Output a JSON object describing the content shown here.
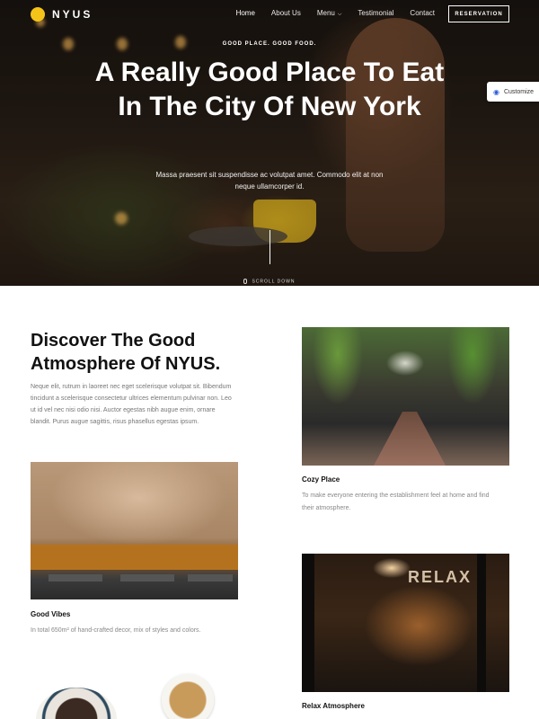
{
  "brand": {
    "name": "NYUS",
    "accent": "#f5c419"
  },
  "nav": {
    "items": [
      {
        "label": "Home",
        "active": true
      },
      {
        "label": "About Us"
      },
      {
        "label": "Menu",
        "has_dropdown": true
      },
      {
        "label": "Testimonial"
      },
      {
        "label": "Contact"
      }
    ],
    "reservation_label": "RESERVATION"
  },
  "customize_label": "Customize",
  "hero": {
    "eyebrow": "GOOD PLACE. GOOD FOOD.",
    "title": "A Really Good Place To Eat In The City Of New York",
    "subtitle": "Massa praesent sit suspendisse ac volutpat amet. Commodo elit at non neque ullamcorper id.",
    "scroll_label": "SCROLL DOWN"
  },
  "discover": {
    "title": "Discover The Good Atmosphere Of NYUS.",
    "body": "Neque elit, rutrum in laoreet nec eget scelerisque volutpat sit. Bibendum tincidunt a scelerisque consectetur ultrices elementum pulvinar non. Leo ut id vel nec nisi odio nisi. Auctor egestas nibh augue enim, ornare blandit. Purus augue sagittis, risus phasellus egestas ipsum."
  },
  "features": {
    "cozy": {
      "title": "Cozy Place",
      "body": "To make everyone entering the establishment feel at home and find their atmosphere."
    },
    "vibes": {
      "title": "Good Vibes",
      "body": "In total 650m² of hand-crafted decor, mix of styles and colors."
    },
    "relax": {
      "title": "Relax Atmosphere",
      "sign_text": "RELAX"
    }
  }
}
